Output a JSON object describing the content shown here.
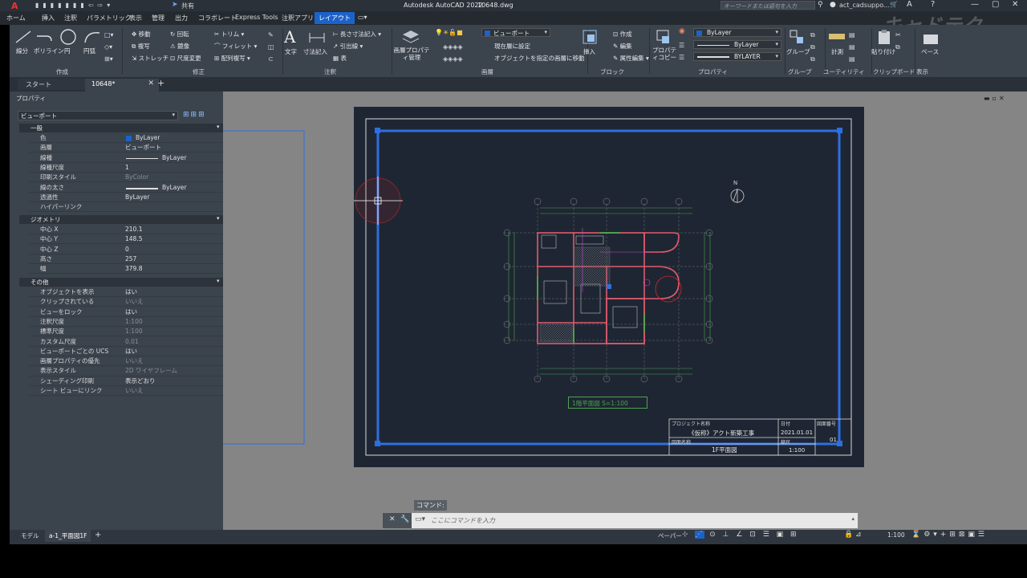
{
  "titlebar": {
    "app_title": "Autodesk AutoCAD 2022",
    "file_name": "10648.dwg",
    "share_label": "共有",
    "search_placeholder": "キーワードまたは語句を入力",
    "user": "act_cadsuppo...",
    "watermark": "キャドテク"
  },
  "menu": [
    "ホーム",
    "挿入",
    "注釈",
    "パラメトリック",
    "表示",
    "管理",
    "出力",
    "コラボレート",
    "Express Tools",
    "注釈アプリ",
    "レイアウト"
  ],
  "menu_active": "レイアウト",
  "ribbon": {
    "draw": {
      "line": "線分",
      "polyline": "ポリライン",
      "circle": "円",
      "arc": "円弧",
      "panel": "作成"
    },
    "modify": {
      "move": "移動",
      "copy": "複写",
      "stretch": "ストレッチ",
      "rotate": "回転",
      "mirror": "鏡像",
      "scale": "尺度変更",
      "trim": "トリム",
      "fillet": "フィレット",
      "array": "配列複写",
      "panel": "修正"
    },
    "annotation": {
      "text": "文字",
      "dimension": "寸法記入",
      "linear": "長さ寸法記入",
      "leader": "引出線",
      "table": "表",
      "panel": "注釈"
    },
    "layers": {
      "props": "画層プロパティ管理",
      "current_layer": "ビューポート",
      "set_current": "現在層に設定",
      "move_to_layer": "オブジェクトを指定の画層に移動",
      "panel": "画層"
    },
    "block": {
      "insert": "挿入",
      "create": "作成",
      "edit": "編集",
      "attr_edit": "属性編集",
      "panel": "ブロック"
    },
    "properties": {
      "match": "プロパティコピー",
      "color": "ByLayer",
      "linetype": "ByLayer",
      "lineweight": "BYLAYER",
      "panel": "プロパティ"
    },
    "groups": {
      "group": "グループ",
      "panel": "グループ"
    },
    "utilities": {
      "measure": "計測",
      "panel": "ユーティリティ"
    },
    "clipboard": {
      "paste": "貼り付け",
      "panel": "クリップボード"
    },
    "view": {
      "base": "ベース",
      "panel": "表示"
    }
  },
  "tabs": {
    "start": "スタート",
    "file": "10648*"
  },
  "props": {
    "title": "プロパティ",
    "selection": "ビューポート",
    "general": {
      "header": "一般",
      "rows": [
        {
          "k": "色",
          "v": "ByLayer"
        },
        {
          "k": "画層",
          "v": "ビューポート"
        },
        {
          "k": "線種",
          "v": "ByLayer"
        },
        {
          "k": "線種尺度",
          "v": "1"
        },
        {
          "k": "印刷スタイル",
          "v": "ByColor"
        },
        {
          "k": "線の太さ",
          "v": "ByLayer"
        },
        {
          "k": "透過性",
          "v": "ByLayer"
        },
        {
          "k": "ハイパーリンク",
          "v": ""
        }
      ]
    },
    "geometry": {
      "header": "ジオメトリ",
      "rows": [
        {
          "k": "中心 X",
          "v": "210.1"
        },
        {
          "k": "中心 Y",
          "v": "148.5"
        },
        {
          "k": "中心 Z",
          "v": "0"
        },
        {
          "k": "高さ",
          "v": "257"
        },
        {
          "k": "幅",
          "v": "379.8"
        }
      ]
    },
    "misc": {
      "header": "その他",
      "rows": [
        {
          "k": "オブジェクトを表示",
          "v": "はい"
        },
        {
          "k": "クリップされている",
          "v": "いいえ"
        },
        {
          "k": "ビューをロック",
          "v": "はい"
        },
        {
          "k": "注釈尺度",
          "v": "1:100"
        },
        {
          "k": "標準尺度",
          "v": "1:100"
        },
        {
          "k": "カスタム尺度",
          "v": "0.01"
        },
        {
          "k": "ビューポートごとの UCS",
          "v": "はい"
        },
        {
          "k": "画層プロパティの優先",
          "v": "いいえ"
        },
        {
          "k": "表示スタイル",
          "v": "2D ワイヤフレーム"
        },
        {
          "k": "シェーディング印刷",
          "v": "表示どおり"
        },
        {
          "k": "シート ビューにリンク",
          "v": "いいえ"
        }
      ]
    }
  },
  "drawing": {
    "plan_title": "1階平面図 S=1:100",
    "project_label": "プロジェクト名称",
    "project_name": "《仮称》アクト新築工事",
    "date_label": "日付",
    "date": "2021.01.01",
    "sheet_no_label": "図面番号",
    "sheet_no": "01",
    "drawing_name_label": "図面名称",
    "drawing_name": "1F平面図",
    "scale_label": "縮尺",
    "scale": "1:100",
    "north": "N"
  },
  "command": {
    "label": "コマンド:",
    "placeholder": "ここにコマンドを入力"
  },
  "status": {
    "model_tab": "モデル",
    "layout_tab": "a-1_平面図1F",
    "paper": "ペーパー",
    "scale": "1:100"
  },
  "colors": {
    "accent": "#1b63c9",
    "viewport_border": "#2d6fe0"
  }
}
